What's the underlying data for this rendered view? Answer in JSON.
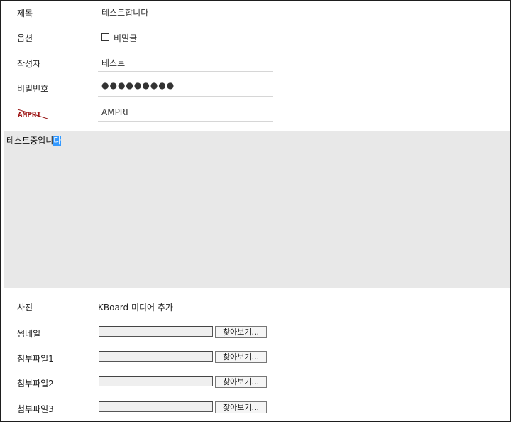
{
  "form": {
    "title": {
      "label": "제목",
      "value": "테스트합니다"
    },
    "options": {
      "label": "옵션",
      "secret_label": "비밀글"
    },
    "author": {
      "label": "작성자",
      "value": "테스트"
    },
    "password": {
      "label": "비밀번호",
      "value": "●●●●●●●●●"
    },
    "captcha": {
      "image_text": "AMPRI",
      "value": "AMPRI"
    },
    "editor": {
      "text": "테스트중입니",
      "selected": "다"
    },
    "photo": {
      "label": "사진",
      "link_text": "KBoard 미디어 추가"
    },
    "thumbnail": {
      "label": "썸네일",
      "button_label": "찾아보기..."
    },
    "attachment1": {
      "label": "첨부파일1",
      "button_label": "찾아보기..."
    },
    "attachment2": {
      "label": "첨부파일2",
      "button_label": "찾아보기..."
    },
    "attachment3": {
      "label": "첨부파일3",
      "button_label": "찾아보기..."
    }
  }
}
